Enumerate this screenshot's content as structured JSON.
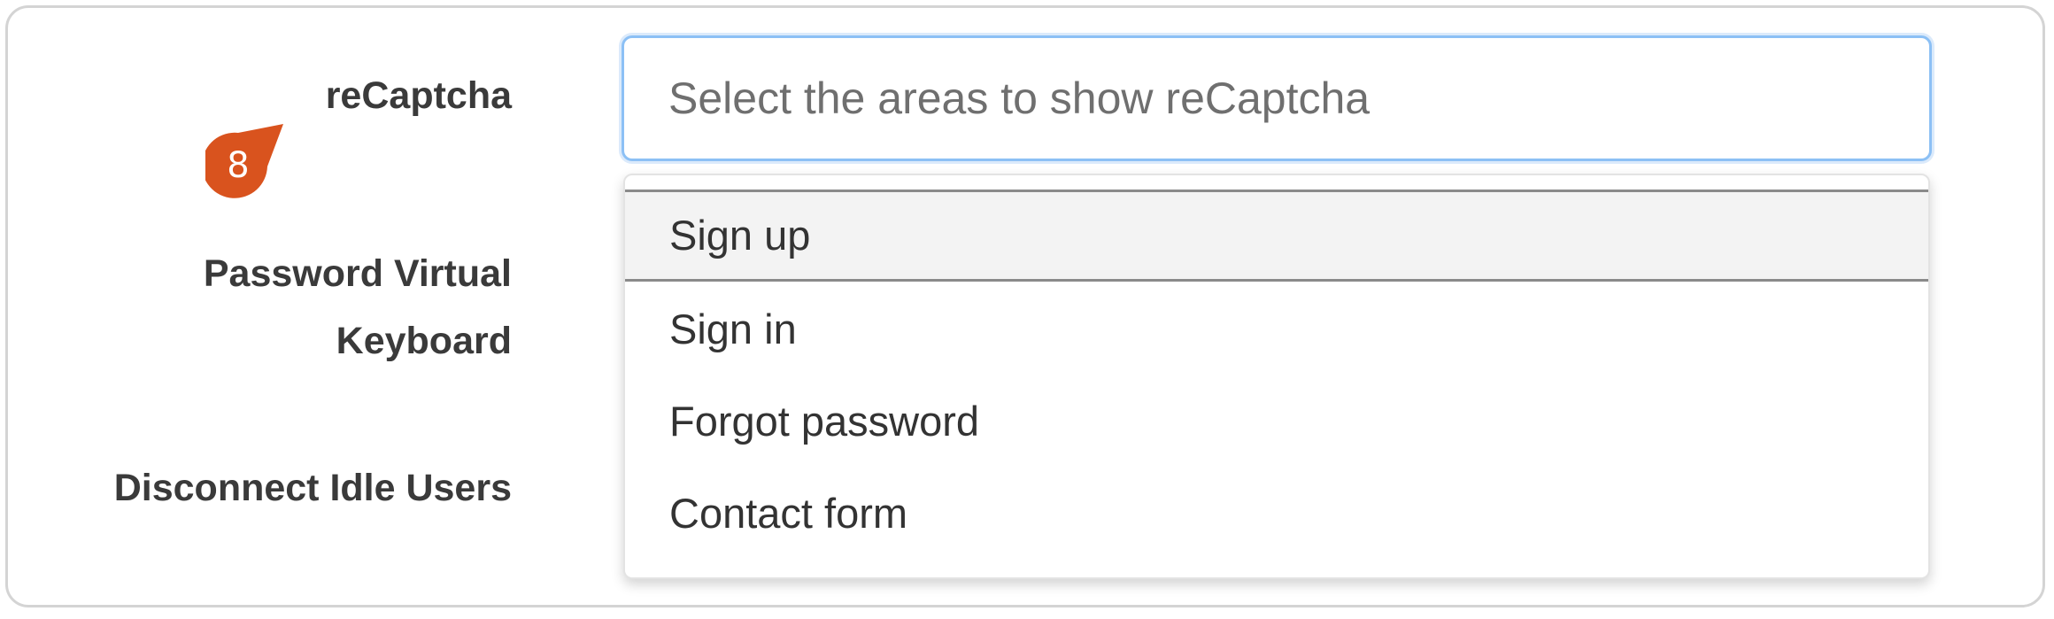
{
  "form": {
    "labels": {
      "recaptcha": "reCaptcha",
      "keyboard_line1": "Password Virtual",
      "keyboard_line2": "Keyboard",
      "idle": "Disconnect Idle Users"
    },
    "recaptcha_select": {
      "placeholder": "Select the areas to show reCaptcha",
      "options": [
        {
          "label": "Sign up",
          "highlighted": true
        },
        {
          "label": "Sign in",
          "highlighted": false
        },
        {
          "label": "Forgot password",
          "highlighted": false
        },
        {
          "label": "Contact form",
          "highlighted": false
        }
      ]
    }
  },
  "annotation": {
    "number": "8",
    "color": "#d9531e"
  },
  "colors": {
    "focus_border": "#8cc0f5",
    "label_text": "#3a3a3a",
    "highlight_bg": "#f3f3f3"
  }
}
